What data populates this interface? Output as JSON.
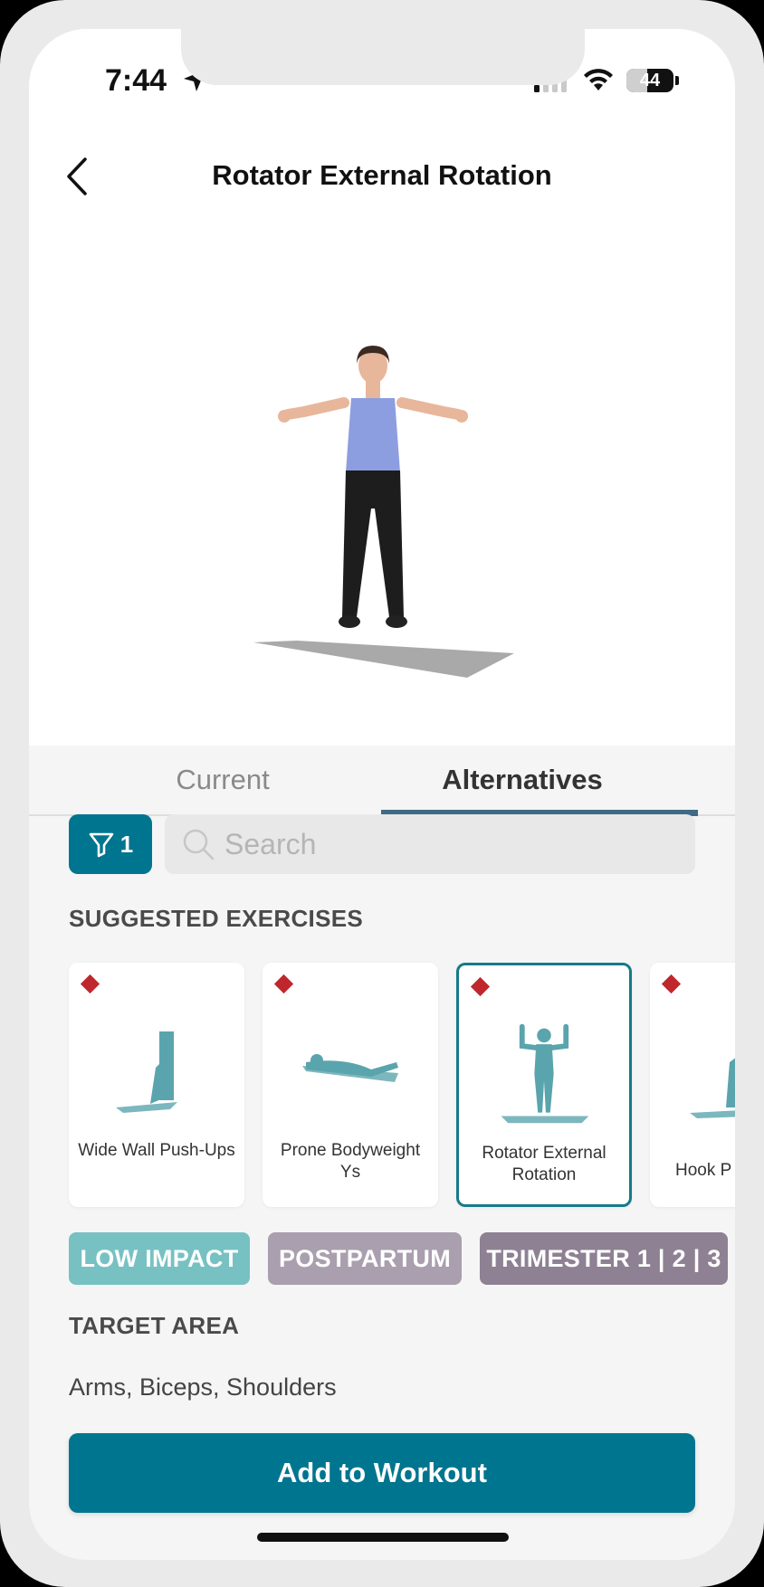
{
  "status_bar": {
    "time": "7:44",
    "battery": "44",
    "battery_level": 0.44
  },
  "header": {
    "title": "Rotator External Rotation",
    "back_icon": "chevron-left-icon"
  },
  "tabs": [
    {
      "label": "Current",
      "active": false
    },
    {
      "label": "Alternatives",
      "active": true
    }
  ],
  "filter": {
    "icon": "filter-icon",
    "count": "1"
  },
  "search": {
    "placeholder": "Search",
    "value": ""
  },
  "suggested": {
    "title": "SUGGESTED EXERCISES",
    "cards": [
      {
        "label": "Wide Wall Push-Ups",
        "selected": false
      },
      {
        "label": "Prone Bodyweight Ys",
        "selected": false
      },
      {
        "label": "Rotator External Rotation",
        "selected": true
      },
      {
        "label": "Hook P",
        "selected": false
      }
    ]
  },
  "tags": [
    {
      "label": "LOW IMPACT",
      "color": "#77c1c3"
    },
    {
      "label": "POSTPARTUM",
      "color": "#a99fae"
    },
    {
      "label": "TRIMESTER 1 | 2 | 3",
      "color": "#8e8193"
    }
  ],
  "target_area": {
    "title": "TARGET AREA",
    "value": "Arms, Biceps, Shoulders"
  },
  "add_button": {
    "label": "Add to Workout"
  },
  "colors": {
    "primary": "#00758f",
    "tab_underline": "#3f6a86",
    "badge": "#c0272d",
    "silhouette": "#5aa4ad"
  }
}
